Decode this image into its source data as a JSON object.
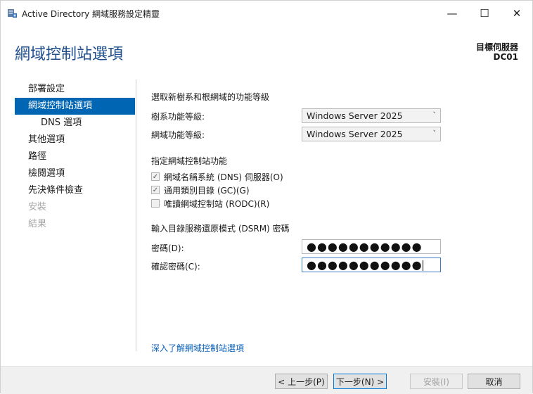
{
  "window": {
    "title": "Active Directory 網域服務設定精靈",
    "minimize_glyph": "—",
    "maximize_glyph": "☐",
    "close_glyph": "✕"
  },
  "header": {
    "page_title": "網域控制站選項",
    "target_server_label": "目標伺服器",
    "target_server_name": "DC01"
  },
  "sidebar": {
    "items": [
      {
        "label": "部署設定",
        "state": "normal"
      },
      {
        "label": "網域控制站選項",
        "state": "active"
      },
      {
        "label": "DNS 選項",
        "state": "sub"
      },
      {
        "label": "其他選項",
        "state": "normal"
      },
      {
        "label": "路徑",
        "state": "normal"
      },
      {
        "label": "檢閱選項",
        "state": "normal"
      },
      {
        "label": "先決條件檢查",
        "state": "normal"
      },
      {
        "label": "安裝",
        "state": "disabled"
      },
      {
        "label": "結果",
        "state": "disabled"
      }
    ]
  },
  "main": {
    "functional_level_heading": "選取新樹系和根網域的功能等級",
    "forest_level_label": "樹系功能等級:",
    "forest_level_value": "Windows Server 2025",
    "domain_level_label": "網域功能等級:",
    "domain_level_value": "Windows Server 2025",
    "dc_capabilities_heading": "指定網域控制站功能",
    "capabilities": [
      {
        "label": "網域名稱系統 (DNS) 伺服器(O)",
        "checked": true
      },
      {
        "label": "通用類別目錄 (GC)(G)",
        "checked": true
      },
      {
        "label": "唯讀網域控制站 (RODC)(R)",
        "checked": false
      }
    ],
    "dsrm_heading": "輸入目錄服務還原模式 (DSRM) 密碼",
    "password_label": "密碼(D):",
    "password_value": "●●●●●●●●●●●",
    "confirm_password_label": "確認密碼(C):",
    "confirm_password_value": "●●●●●●●●●●●",
    "help_link": "深入了解網域控制站選項"
  },
  "footer": {
    "prev_label": "< 上一步(P)",
    "next_label": "下一步(N) >",
    "install_label": "安裝(I)",
    "cancel_label": "取消"
  },
  "colors": {
    "accent": "#0066b4",
    "heading": "#1e4e8c",
    "link": "#0b61b8"
  }
}
